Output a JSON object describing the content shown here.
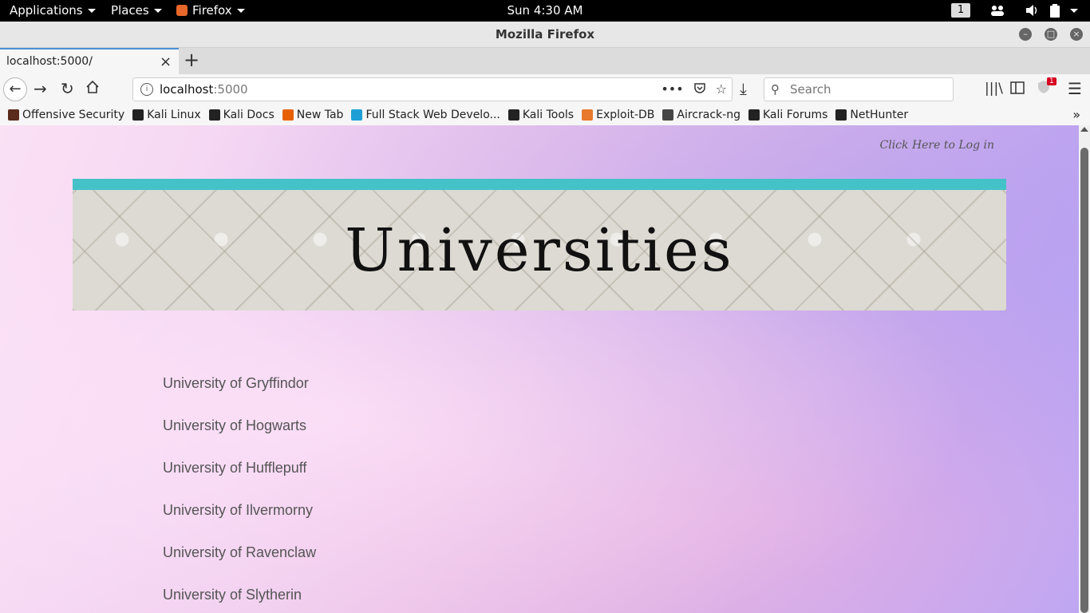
{
  "topbar": {
    "applications": "Applications",
    "places": "Places",
    "firefox": "Firefox",
    "clock": "Sun  4:30 AM",
    "workspace": "1"
  },
  "window": {
    "title": "Mozilla Firefox"
  },
  "tab": {
    "label": "localhost:5000/"
  },
  "navbar": {
    "url_host": "localhost",
    "url_port": ":5000",
    "search_placeholder": "Search",
    "notification_count": "1"
  },
  "bookmarks": [
    {
      "label": "Offensive Security",
      "icon": "offsec-icon",
      "color": "#5a2a1a"
    },
    {
      "label": "Kali Linux",
      "icon": "kali-icon",
      "color": "#222222"
    },
    {
      "label": "Kali Docs",
      "icon": "kali-icon",
      "color": "#222222"
    },
    {
      "label": "New Tab",
      "icon": "firefox-icon",
      "color": "#e66000"
    },
    {
      "label": "Full Stack Web Develo...",
      "icon": "udemy-icon",
      "color": "#1f9fd6"
    },
    {
      "label": "Kali Tools",
      "icon": "kali-icon",
      "color": "#222222"
    },
    {
      "label": "Exploit-DB",
      "icon": "exploitdb-icon",
      "color": "#e8782b"
    },
    {
      "label": "Aircrack-ng",
      "icon": "aircrack-icon",
      "color": "#444444"
    },
    {
      "label": "Kali Forums",
      "icon": "kali-icon",
      "color": "#222222"
    },
    {
      "label": "NetHunter",
      "icon": "kali-icon",
      "color": "#222222"
    }
  ],
  "page": {
    "login_link": "Click Here to Log in",
    "banner_title": "Universities",
    "universities": [
      "University of Gryffindor",
      "University of Hogwarts",
      "University of Hufflepuff",
      "University of Ilvermorny",
      "University of Ravenclaw",
      "University of Slytherin"
    ]
  },
  "colors": {
    "banner_strip": "#44c2c8",
    "tab_accent": "#4a90d9",
    "badge": "#d70022"
  }
}
